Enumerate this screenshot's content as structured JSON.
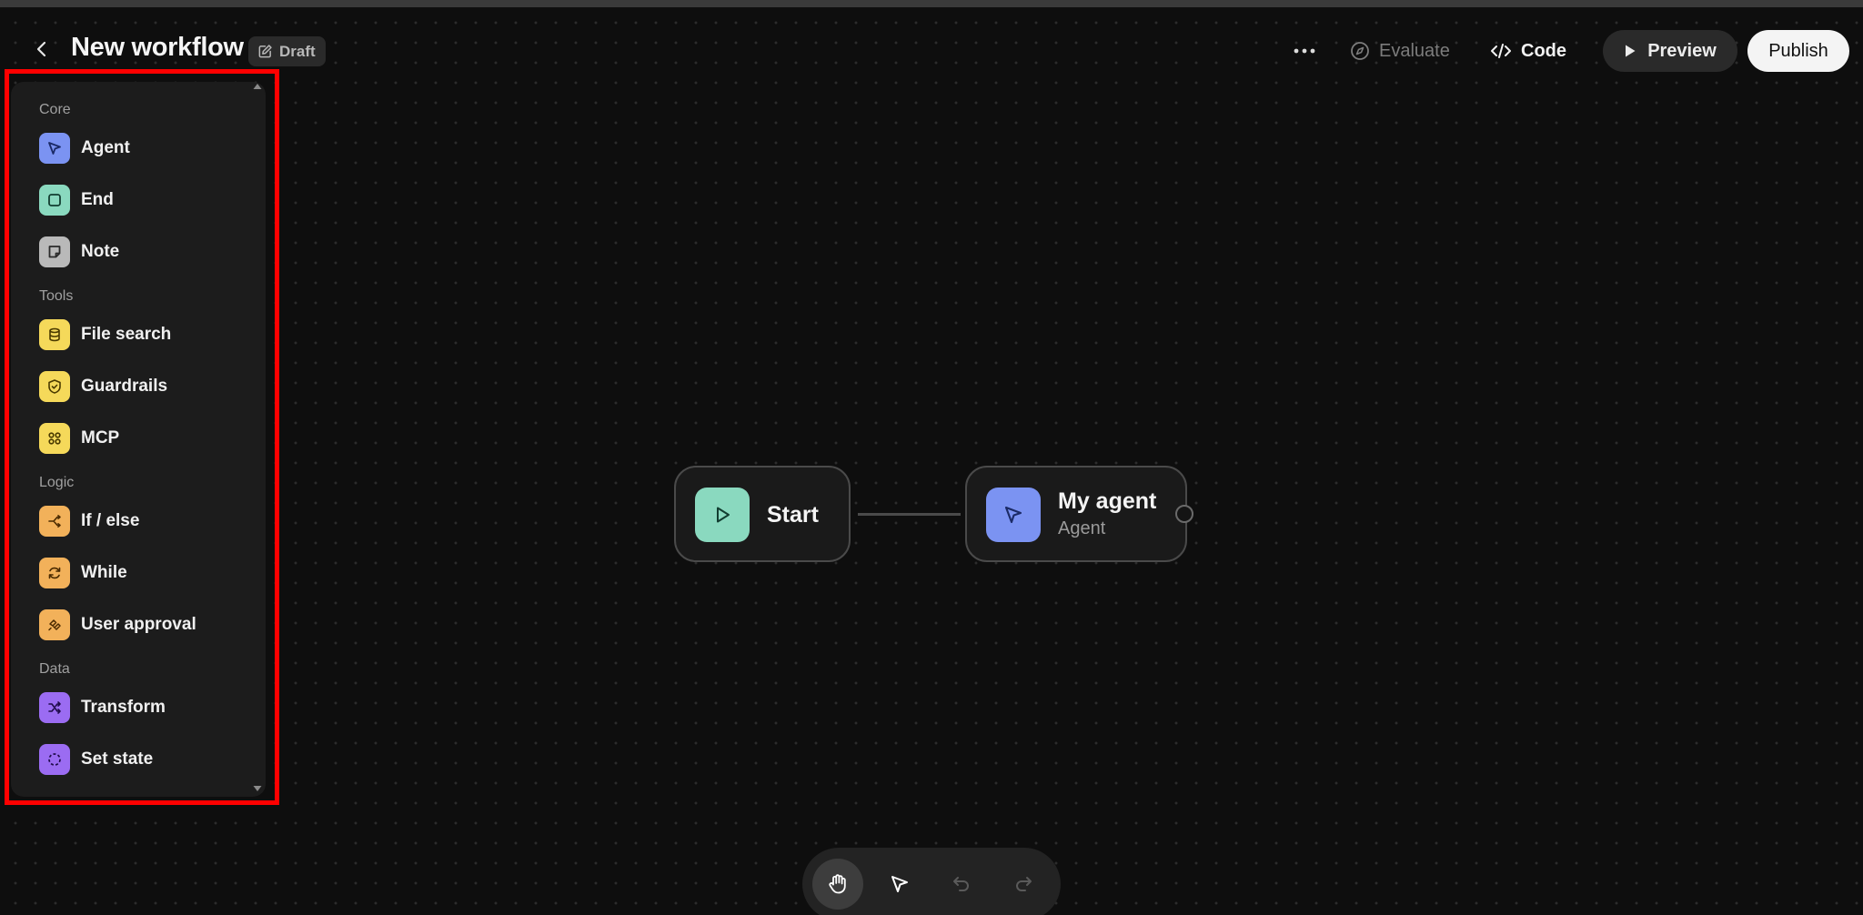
{
  "header": {
    "title": "New workflow",
    "draft_label": "Draft",
    "evaluate_label": "Evaluate",
    "code_label": "Code",
    "preview_label": "Preview",
    "publish_label": "Publish"
  },
  "palette": {
    "sections": [
      {
        "label": "Core",
        "items": [
          {
            "label": "Agent",
            "icon": "pointer-icon",
            "color": "#7b93f2"
          },
          {
            "label": "End",
            "icon": "square-icon",
            "color": "#8ad9bf"
          },
          {
            "label": "Note",
            "icon": "sticky-note-icon",
            "color": "#b9b9b9"
          }
        ]
      },
      {
        "label": "Tools",
        "items": [
          {
            "label": "File search",
            "icon": "database-icon",
            "color": "#f5d95a"
          },
          {
            "label": "Guardrails",
            "icon": "shield-check-icon",
            "color": "#f5d95a"
          },
          {
            "label": "MCP",
            "icon": "mcp-icon",
            "color": "#f5d95a"
          }
        ]
      },
      {
        "label": "Logic",
        "items": [
          {
            "label": "If / else",
            "icon": "branch-icon",
            "color": "#f2b15a"
          },
          {
            "label": "While",
            "icon": "loop-icon",
            "color": "#f2b15a"
          },
          {
            "label": "User approval",
            "icon": "hand-approval-icon",
            "color": "#f2b15a"
          }
        ]
      },
      {
        "label": "Data",
        "items": [
          {
            "label": "Transform",
            "icon": "shuffle-icon",
            "color": "#9b6cf2"
          },
          {
            "label": "Set state",
            "icon": "dashed-circle-icon",
            "color": "#9b6cf2"
          }
        ]
      }
    ]
  },
  "nodes": {
    "start": {
      "label": "Start",
      "icon": "play-icon",
      "color": "#8ad9bf"
    },
    "agent": {
      "label": "My agent",
      "sublabel": "Agent",
      "icon": "pointer-icon",
      "color": "#7b93f2"
    }
  },
  "toolbar": {
    "tools": [
      "hand-icon",
      "pointer-icon",
      "undo-icon",
      "redo-icon"
    ],
    "active": "hand-icon"
  }
}
